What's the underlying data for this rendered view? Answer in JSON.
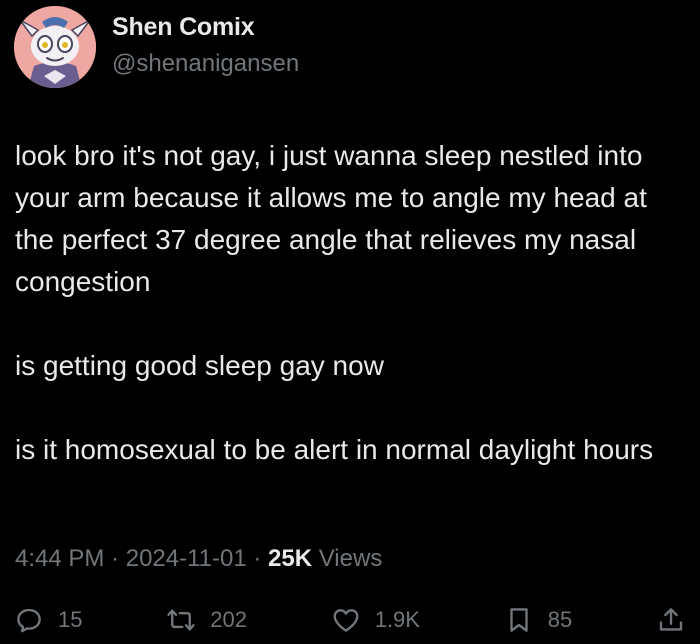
{
  "author": {
    "display_name": "Shen Comix",
    "handle": "@shenanigansen",
    "avatar_icon": "cartoon-avatar"
  },
  "body": {
    "paragraphs": [
      "look bro it's not gay, i just wanna sleep nestled into your arm because it allows me to angle my head at the perfect 37 degree angle that relieves my nasal congestion",
      "is getting good sleep gay now",
      "is it homosexual to be alert in normal daylight hours"
    ]
  },
  "meta": {
    "time": "4:44 PM",
    "separator": " · ",
    "date": "2024-11-01",
    "views_count": "25K",
    "views_label": " Views"
  },
  "actions": {
    "replies": "15",
    "reposts": "202",
    "likes": "1.9K",
    "bookmarks": "85"
  },
  "colors": {
    "background": "#000000",
    "primary_text": "#e7e9ea",
    "secondary_text": "#71767b",
    "avatar_bg": "#efa7a1"
  }
}
